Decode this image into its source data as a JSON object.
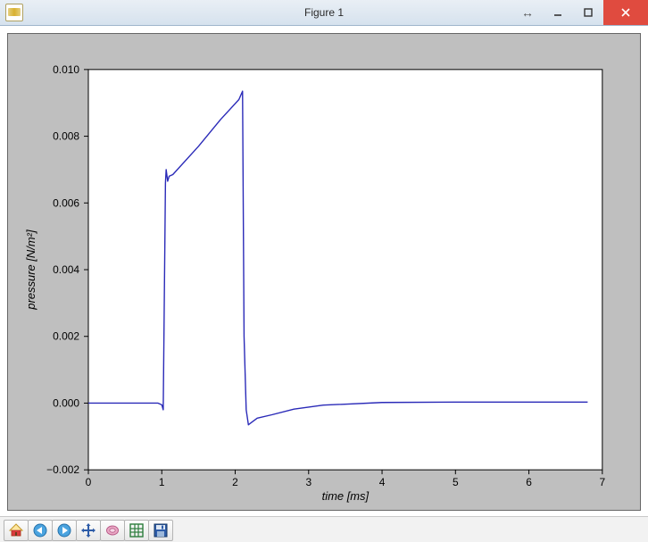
{
  "window": {
    "title": "Figure 1"
  },
  "toolbar": {
    "items": [
      {
        "name": "home-button",
        "icon": "home-icon"
      },
      {
        "name": "back-button",
        "icon": "arrow-left-icon"
      },
      {
        "name": "forward-button",
        "icon": "arrow-right-icon"
      },
      {
        "name": "pan-button",
        "icon": "move-icon"
      },
      {
        "name": "zoom-button",
        "icon": "zoom-rect-icon"
      },
      {
        "name": "subplots-button",
        "icon": "subplots-icon"
      },
      {
        "name": "save-button",
        "icon": "save-icon"
      }
    ]
  },
  "chart_data": {
    "type": "line",
    "title": "",
    "xlabel": "time [ms]",
    "ylabel": "pressure [N/m²]",
    "xlim": [
      0,
      7
    ],
    "ylim": [
      -0.002,
      0.01
    ],
    "xticks": [
      0,
      1,
      2,
      3,
      4,
      5,
      6,
      7
    ],
    "yticks": [
      -0.002,
      0.0,
      0.002,
      0.004,
      0.006,
      0.008,
      0.01
    ],
    "ytick_labels": [
      "−0.002",
      "0.000",
      "0.002",
      "0.004",
      "0.006",
      "0.008",
      "0.010"
    ],
    "series": [
      {
        "name": "pressure",
        "color": "#2a2ab8",
        "x": [
          0.0,
          0.95,
          1.0,
          1.02,
          1.05,
          1.06,
          1.08,
          1.1,
          1.15,
          1.5,
          1.8,
          2.05,
          2.1,
          2.12,
          2.15,
          2.18,
          2.22,
          2.3,
          2.5,
          2.8,
          3.2,
          4.0,
          5.0,
          6.0,
          6.8
        ],
        "y": [
          0.0,
          0.0,
          -5e-05,
          -0.0002,
          0.0066,
          0.007,
          0.00665,
          0.0068,
          0.00685,
          0.0077,
          0.0085,
          0.0091,
          0.00935,
          0.002,
          -0.0002,
          -0.00065,
          -0.00058,
          -0.00045,
          -0.00035,
          -0.00018,
          -6e-05,
          2e-05,
          3e-05,
          3e-05,
          3e-05
        ]
      }
    ]
  }
}
